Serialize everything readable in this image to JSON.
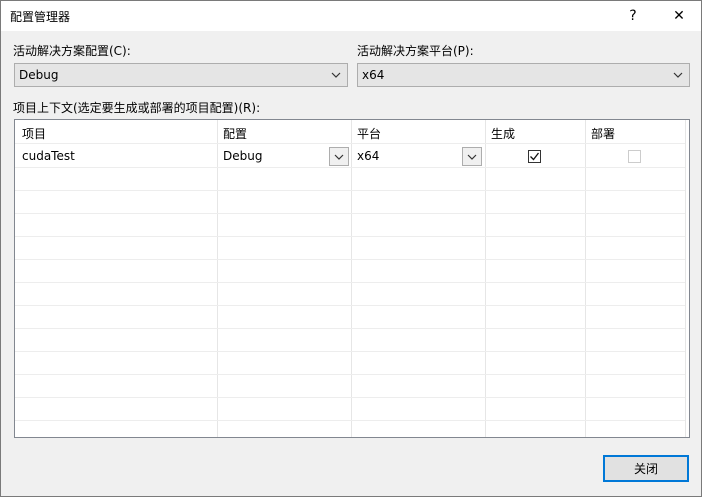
{
  "dialog": {
    "title": "配置管理器",
    "help_icon": "?",
    "close_icon": "✕"
  },
  "solution": {
    "config_label": "活动解决方案配置(C):",
    "config_value": "Debug",
    "platform_label": "活动解决方案平台(P):",
    "platform_value": "x64"
  },
  "grid": {
    "label": "项目上下文(选定要生成或部署的项目配置)(R):",
    "headers": [
      "项目",
      "配置",
      "平台",
      "生成",
      "部署"
    ],
    "rows": [
      {
        "project": "cudaTest",
        "config": "Debug",
        "platform": "x64",
        "build": true,
        "deploy": false
      }
    ]
  },
  "buttons": {
    "close_label": "关闭"
  },
  "icons": {
    "dropdown": "chevron-down-icon",
    "help": "help-icon",
    "close": "close-icon",
    "checked": "checkbox-checked-icon",
    "unchecked": "checkbox-unchecked-icon"
  }
}
